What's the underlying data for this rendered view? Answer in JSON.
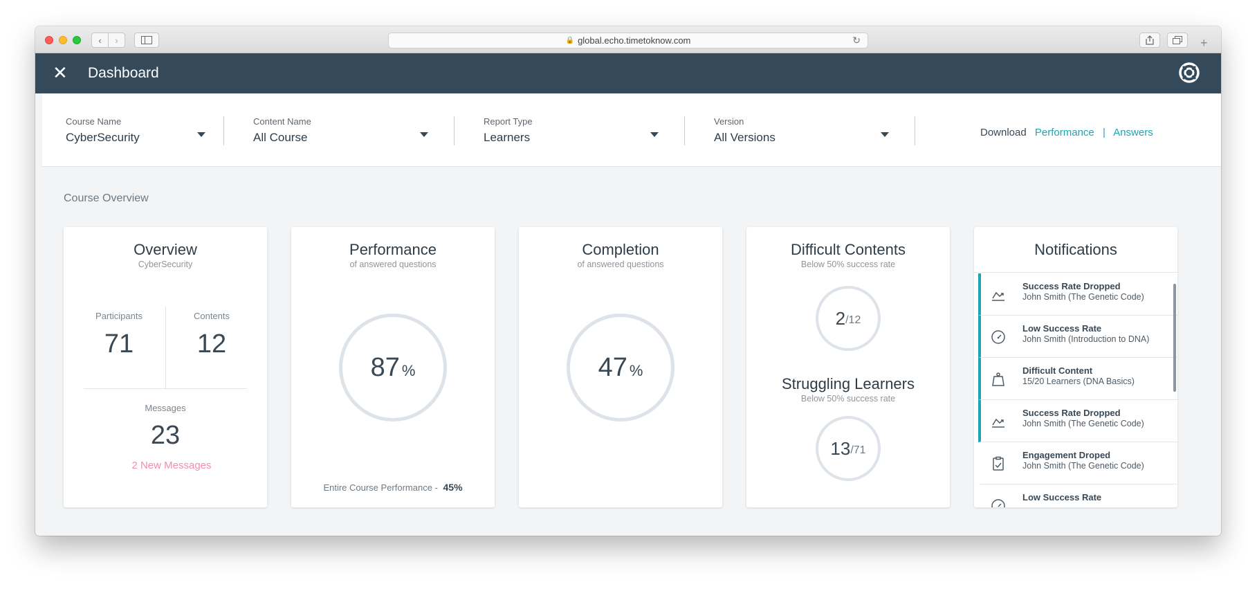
{
  "browser": {
    "url": "global.echo.timetoknow.com"
  },
  "header": {
    "title": "Dashboard"
  },
  "filters": [
    {
      "label": "Course Name",
      "value": "CyberSecurity"
    },
    {
      "label": "Content Name",
      "value": "All Course"
    },
    {
      "label": "Report Type",
      "value": "Learners"
    },
    {
      "label": "Version",
      "value": "All Versions"
    }
  ],
  "download": {
    "label": "Download",
    "performance": "Performance",
    "separator": "|",
    "answers": "Answers"
  },
  "section_title": "Course Overview",
  "overview": {
    "title": "Overview",
    "subtitle": "CyberSecurity",
    "participants_label": "Participants",
    "participants": "71",
    "contents_label": "Contents",
    "contents": "12",
    "messages_label": "Messages",
    "messages": "23",
    "new_messages": "2 New Messages"
  },
  "performance": {
    "title": "Performance",
    "subtitle": "of answered questions",
    "value": "87",
    "unit": "%",
    "footer_label": "Entire Course Performance -",
    "footer_value": "45%"
  },
  "completion": {
    "title": "Completion",
    "subtitle": "of answered questions",
    "value": "47",
    "unit": "%"
  },
  "difficult": {
    "title": "Difficult Contents",
    "subtitle": "Below 50% success rate",
    "value": "2",
    "total": "/12",
    "struggling_title": "Struggling Learners",
    "struggling_subtitle": "Below 50% success rate",
    "struggling_value": "13",
    "struggling_total": "/71"
  },
  "notifications": {
    "title": "Notifications",
    "items": [
      {
        "title": "Success Rate Dropped",
        "desc": "John Smith (The Genetic Code)",
        "icon": "chart-down-icon",
        "highlight": true
      },
      {
        "title": "Low Success Rate",
        "desc": "John Smith (Introduction to DNA)",
        "icon": "gauge-icon",
        "highlight": true
      },
      {
        "title": "Difficult Content",
        "desc": "15/20 Learners (DNA Basics)",
        "icon": "weight-icon",
        "highlight": true
      },
      {
        "title": "Success Rate Dropped",
        "desc": "John Smith (The Genetic Code)",
        "icon": "chart-down-icon",
        "highlight": true
      },
      {
        "title": "Engagement Droped",
        "desc": "John Smith (The Genetic Code)",
        "icon": "clipboard-icon",
        "highlight": false
      },
      {
        "title": "Low Success Rate",
        "desc": "",
        "icon": "gauge-icon",
        "highlight": false
      }
    ]
  }
}
